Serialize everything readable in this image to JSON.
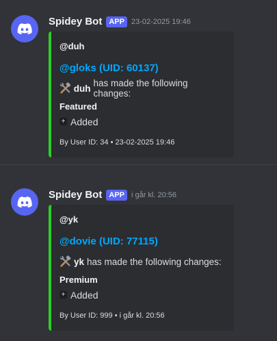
{
  "messages": [
    {
      "username": "Spidey Bot",
      "badge": "APP",
      "timestamp": "23-02-2025 19:46",
      "embed": {
        "author": "@duh",
        "title": "@gloks (UID: 60137)",
        "actor": "duh",
        "description": "has made the following changes:",
        "field_name": "Featured",
        "field_value": "Added",
        "footer": "By User ID: 34 • 23-02-2025 19:46",
        "border_color": "#2ecc2a"
      }
    },
    {
      "username": "Spidey Bot",
      "badge": "APP",
      "timestamp": "i går kl. 20:56",
      "embed": {
        "author": "@yk",
        "title": "@dovie (UID: 77115)",
        "actor": "yk",
        "description": "has made the following changes:",
        "field_name": "Premium",
        "field_value": "Added",
        "footer": "By User ID: 999 • i går kl. 20:56",
        "border_color": "#2ecc2a"
      }
    }
  ],
  "icons": {
    "avatar": "discord-logo-icon",
    "description": "hammer-and-wrench-icon",
    "field_value": "plus-icon"
  },
  "colors": {
    "background": "#313338",
    "embed_background": "#2b2d31",
    "link": "#00a8fc",
    "badge": "#5865f2"
  }
}
